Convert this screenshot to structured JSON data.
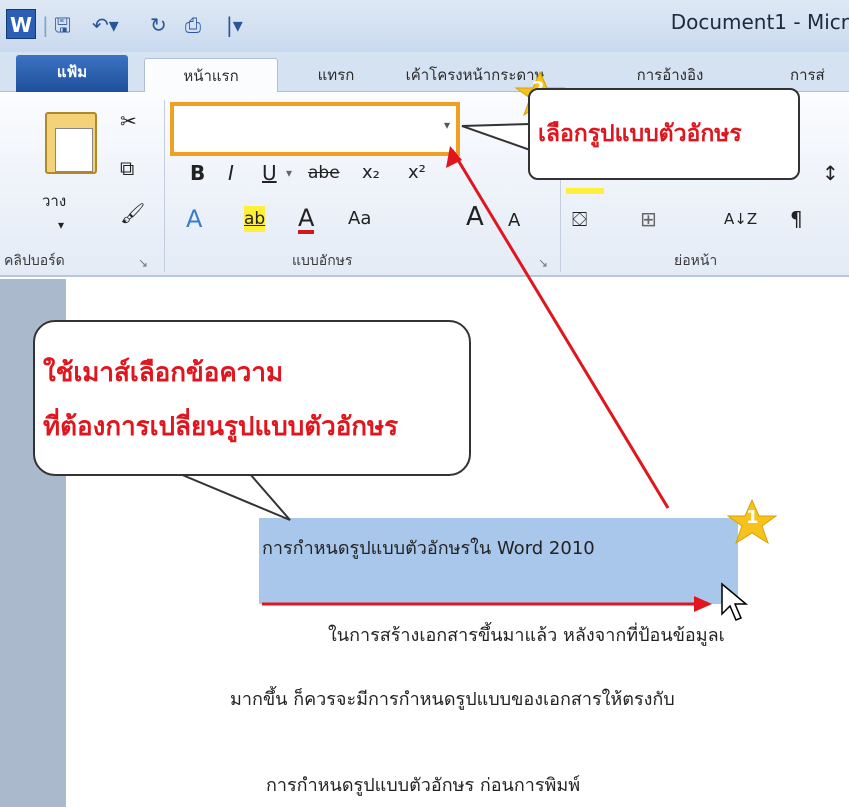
{
  "window": {
    "title": "Document1 - Micr"
  },
  "quick_access": {
    "logo_letter": "W",
    "separator": "|"
  },
  "tabs": [
    "แฟ้ม",
    "หน้าแรก",
    "แทรก",
    "เค้าโครงหน้ากระดาษ",
    "การอ้างอิง",
    "การส่"
  ],
  "ribbon": {
    "clipboard": {
      "paste_label": "วาง",
      "group_label": "คลิปบอร์ด"
    },
    "font": {
      "group_label": "แบบอักษร",
      "font_name_value": "",
      "bold": "B",
      "italic": "I",
      "underline": "U",
      "strike": "abe",
      "subscript": "x₂",
      "superscript": "x²",
      "text_effect": "A",
      "highlight": "ab",
      "font_color": "A",
      "change_case": "Aa",
      "grow": "A",
      "shrink": "A"
    },
    "paragraph": {
      "group_label": "ย่อหน้า",
      "sort": "A↓Z",
      "pilcrow": "¶"
    }
  },
  "callouts": {
    "step2_badge": "2",
    "step2_text": "เลือกรูปแบบตัวอักษร",
    "step1_badge": "1",
    "instruction_line1": "ใช้เมาส์เลือกข้อความ",
    "instruction_line2": "ที่ต้องการเปลี่ยนรูปแบบตัวอักษร"
  },
  "document": {
    "selected_text": "การกำหนดรูปแบบตัวอักษรใน Word 2010",
    "para1": "ในการสร้างเอกสารขึ้นมาแล้ว หลังจากที่ป้อนข้อมูลเ",
    "para2": "มากขึ้น ก็ควรจะมีการกำหนดรูปแบบของเอกสารให้ตรงกับ",
    "para3": "การกำหนดรูปแบบตัวอักษร ก่อนการพิมพ์"
  },
  "colors": {
    "annotation_red": "#e0151d",
    "highlight_orange": "#f0a020",
    "selection_blue": "#a8c7ea",
    "star_yellow": "#f6c21b"
  }
}
